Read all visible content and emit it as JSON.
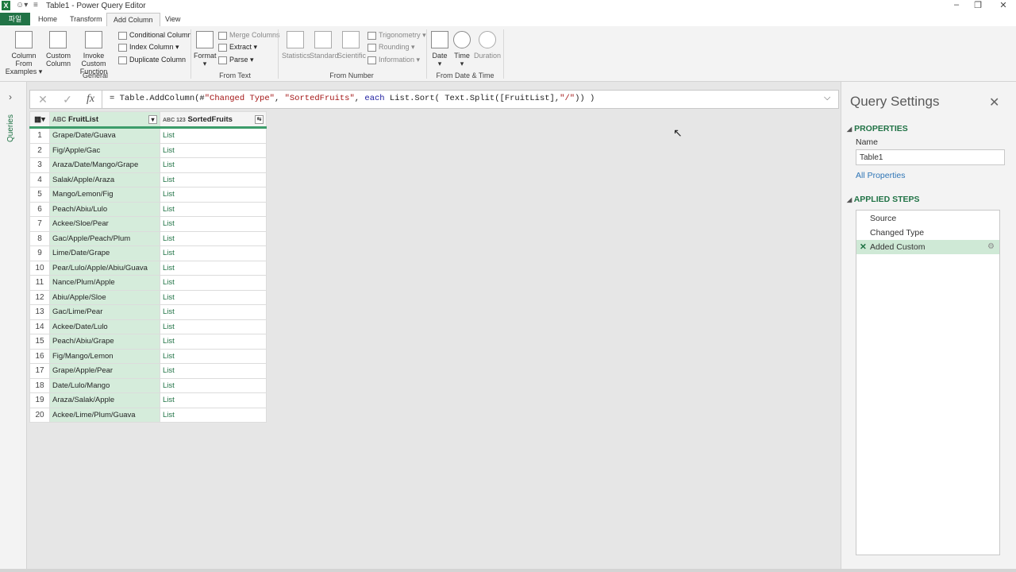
{
  "titlebar": {
    "title": "Table1 - Power Query Editor",
    "app_icon": "X"
  },
  "tabs": [
    "파일",
    "Home",
    "Transform",
    "Add Column",
    "View"
  ],
  "active_tab": "Add Column",
  "ribbon": {
    "general": {
      "group": "General",
      "column_from_examples": [
        "Column From",
        "Examples ▾"
      ],
      "custom_column": [
        "Custom",
        "Column"
      ],
      "invoke_custom_function": [
        "Invoke Custom",
        "Function"
      ],
      "conditional_column": "Conditional Column",
      "index_column": "Index Column ▾",
      "duplicate_column": "Duplicate Column"
    },
    "from_text": {
      "group": "From Text",
      "format": "Format",
      "merge_columns": "Merge Columns",
      "extract": "Extract ▾",
      "parse": "Parse ▾"
    },
    "from_number": {
      "group": "From Number",
      "statistics": "Statistics",
      "standard": "Standard",
      "scientific": "Scientific",
      "trigonometry": "Trigonometry ▾",
      "rounding": "Rounding ▾",
      "information": "Information ▾"
    },
    "from_date_time": {
      "group": "From Date & Time",
      "date": "Date",
      "time": "Time",
      "duration": "Duration"
    }
  },
  "left_pane": {
    "label": "Queries"
  },
  "formula_bar": {
    "fx": "fx",
    "p1": "= Table.AddColumn(#",
    "s1": "\"Changed Type\"",
    "p2": ", ",
    "s2": "\"SortedFruits\"",
    "p3": ", ",
    "k1": "each",
    "p4": " List.Sort( Text.Split([FruitList],",
    "s3": "\"/\"",
    "p5": ")) )"
  },
  "table": {
    "columns": [
      {
        "name": "FruitList",
        "type": "ABC"
      },
      {
        "name": "SortedFruits",
        "type": "ABC 123"
      }
    ],
    "rows": [
      [
        "1",
        "Grape/Date/Guava",
        "List"
      ],
      [
        "2",
        "Fig/Apple/Gac",
        "List"
      ],
      [
        "3",
        "Araza/Date/Mango/Grape",
        "List"
      ],
      [
        "4",
        "Salak/Apple/Araza",
        "List"
      ],
      [
        "5",
        "Mango/Lemon/Fig",
        "List"
      ],
      [
        "6",
        "Peach/Abiu/Lulo",
        "List"
      ],
      [
        "7",
        "Ackee/Sloe/Pear",
        "List"
      ],
      [
        "8",
        "Gac/Apple/Peach/Plum",
        "List"
      ],
      [
        "9",
        "Lime/Date/Grape",
        "List"
      ],
      [
        "10",
        "Pear/Lulo/Apple/Abiu/Guava",
        "List"
      ],
      [
        "11",
        "Nance/Plum/Apple",
        "List"
      ],
      [
        "12",
        "Abiu/Apple/Sloe",
        "List"
      ],
      [
        "13",
        "Gac/Lime/Pear",
        "List"
      ],
      [
        "14",
        "Ackee/Date/Lulo",
        "List"
      ],
      [
        "15",
        "Peach/Abiu/Grape",
        "List"
      ],
      [
        "16",
        "Fig/Mango/Lemon",
        "List"
      ],
      [
        "17",
        "Grape/Apple/Pear",
        "List"
      ],
      [
        "18",
        "Date/Lulo/Mango",
        "List"
      ],
      [
        "19",
        "Araza/Salak/Apple",
        "List"
      ],
      [
        "20",
        "Ackee/Lime/Plum/Guava",
        "List"
      ]
    ]
  },
  "query_settings": {
    "title": "Query Settings",
    "properties_heading": "PROPERTIES",
    "name_label": "Name",
    "name_value": "Table1",
    "all_properties": "All Properties",
    "applied_steps_heading": "APPLIED STEPS",
    "steps": [
      "Source",
      "Changed Type",
      "Added Custom"
    ],
    "selected_step": "Added Custom"
  },
  "colors": {
    "accent": "#217346",
    "selected_column": "#d5ecdb",
    "link": "#2e75b6"
  }
}
